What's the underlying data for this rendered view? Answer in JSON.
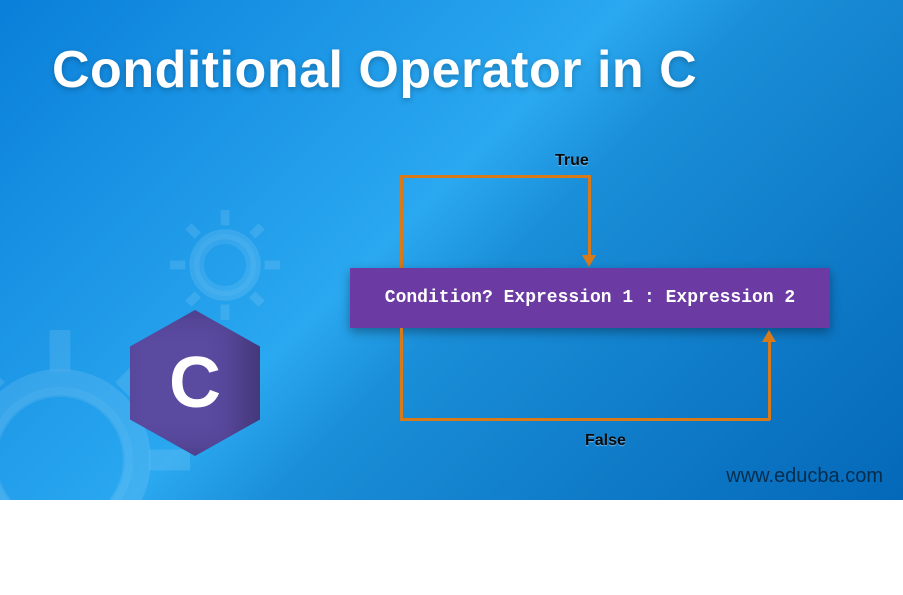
{
  "title": "Conditional Operator in C",
  "logo_letter": "C",
  "diagram": {
    "true_label": "True",
    "false_label": "False",
    "syntax": "Condition? Expression 1 : Expression 2"
  },
  "watermark": "www.educba.com",
  "colors": {
    "bg_start": "#0a7fd9",
    "bg_end": "#0468b8",
    "box": "#6b3aa2",
    "connector": "#d97a1a",
    "hex": "#5a4aa0"
  }
}
